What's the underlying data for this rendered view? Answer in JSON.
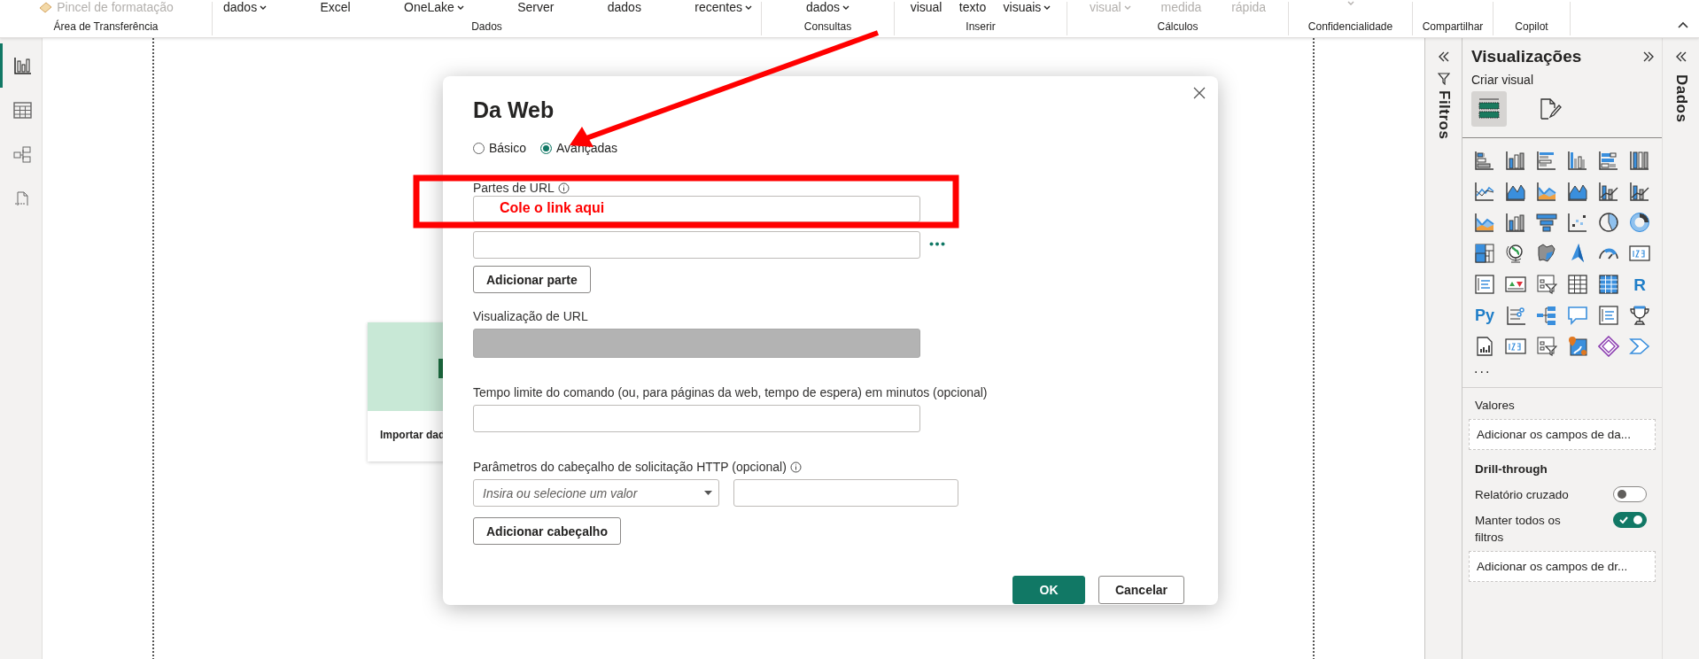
{
  "ribbon": {
    "groups": [
      {
        "label": "Área de Transferência",
        "items": [
          {
            "text": "Pincel de formatação",
            "disabled": true,
            "kind": "brush"
          }
        ]
      },
      {
        "label": "Dados",
        "items": [
          {
            "text": "dados",
            "dropdown": true
          },
          {
            "text": "Excel"
          },
          {
            "text": "OneLake",
            "dropdown": true
          },
          {
            "text": "Server"
          },
          {
            "text": "dados"
          },
          {
            "text": "recentes",
            "dropdown": true
          }
        ]
      },
      {
        "label": "Consultas",
        "items": [
          {
            "text": "dados",
            "dropdown": true
          }
        ]
      },
      {
        "label": "Inserir",
        "items": [
          {
            "text": "visual"
          },
          {
            "text": "texto"
          },
          {
            "text": "visuais",
            "dropdown": true
          }
        ]
      },
      {
        "label": "Cálculos",
        "items": [
          {
            "text": "visual",
            "dropdown": true,
            "disabled": true
          },
          {
            "text": "medida",
            "disabled": true
          },
          {
            "text": "rápida",
            "disabled": true
          }
        ]
      },
      {
        "label": "Confidencialidade",
        "items": [
          {
            "kind": "caret",
            "disabled": true
          }
        ]
      },
      {
        "label": "Compartilhar"
      },
      {
        "label": "Copilot"
      }
    ]
  },
  "nav": [
    {
      "kind": "report",
      "selected": true
    },
    {
      "kind": "table",
      "selected": false
    },
    {
      "kind": "model",
      "selected": false
    },
    {
      "kind": "dax",
      "selected": false
    }
  ],
  "canvas": {
    "card": {
      "text": "Importar dad"
    }
  },
  "dialog": {
    "title": "Da Web",
    "modes": [
      {
        "label": "Básico",
        "selected": false
      },
      {
        "label": "Avançadas",
        "selected": true
      }
    ],
    "url_parts_label": "Partes de URL",
    "url_parts": [
      {
        "note": "Cole o link aqui",
        "has_menu": false
      },
      {
        "has_menu": true
      }
    ],
    "add_part_button": "Adicionar parte",
    "preview_label": "Visualização de URL",
    "timeout_label": "Tempo limite do comando (ou, para páginas da web, tempo de espera) em minutos (opcional)",
    "headers_label": "Parâmetros do cabeçalho de solicitação HTTP (opcional)",
    "header_name_placeholder": "Insira ou selecione um valor",
    "add_header_button": "Adicionar cabeçalho",
    "ok_button": "OK",
    "cancel_button": "Cancelar"
  },
  "filters_pane": {
    "title": "Filtros"
  },
  "visualizations": {
    "title": "Visualizações",
    "subtitle": "Criar visual",
    "modes": [
      {
        "kind": "build",
        "selected": true
      },
      {
        "kind": "format",
        "selected": false
      }
    ],
    "visual_types": [
      {
        "kind": "stacked-bar"
      },
      {
        "kind": "stacked-column"
      },
      {
        "kind": "clustered-bar"
      },
      {
        "kind": "clustered-column"
      },
      {
        "kind": "bar100"
      },
      {
        "kind": "column100"
      },
      {
        "kind": "line"
      },
      {
        "kind": "area"
      },
      {
        "kind": "stacked-area"
      },
      {
        "kind": "area"
      },
      {
        "kind": "line-column"
      },
      {
        "kind": "line-column"
      },
      {
        "kind": "ribbon"
      },
      {
        "kind": "waterfall"
      },
      {
        "kind": "funnel"
      },
      {
        "kind": "scatter"
      },
      {
        "kind": "pie"
      },
      {
        "kind": "donut"
      },
      {
        "kind": "treemap"
      },
      {
        "kind": "map"
      },
      {
        "kind": "filled-map"
      },
      {
        "kind": "azure-map"
      },
      {
        "kind": "gauge"
      },
      {
        "kind": "card"
      },
      {
        "kind": "multirow-card"
      },
      {
        "kind": "kpi"
      },
      {
        "kind": "slicer"
      },
      {
        "kind": "table"
      },
      {
        "kind": "matrix"
      },
      {
        "kind": "r-script",
        "label": "R"
      },
      {
        "kind": "python",
        "label": "Py"
      },
      {
        "kind": "key-influencers"
      },
      {
        "kind": "decomposition-tree"
      },
      {
        "kind": "qa"
      },
      {
        "kind": "narrative"
      },
      {
        "kind": "metrics"
      },
      {
        "kind": "paginated"
      },
      {
        "kind": "card"
      },
      {
        "kind": "slicer"
      },
      {
        "kind": "map-pin"
      },
      {
        "kind": "power-apps"
      },
      {
        "kind": "power-automate"
      }
    ],
    "more": "...",
    "values_label": "Valores",
    "values_drop": "Adicionar os campos de da...",
    "drillthrough": {
      "title": "Drill-through",
      "toggles": [
        {
          "label": "Relatório cruzado",
          "on": false
        },
        {
          "label": "Manter todos os filtros",
          "on": true
        }
      ],
      "drop": "Adicionar os campos de dr..."
    }
  },
  "data_pane": {
    "title": "Dados"
  }
}
